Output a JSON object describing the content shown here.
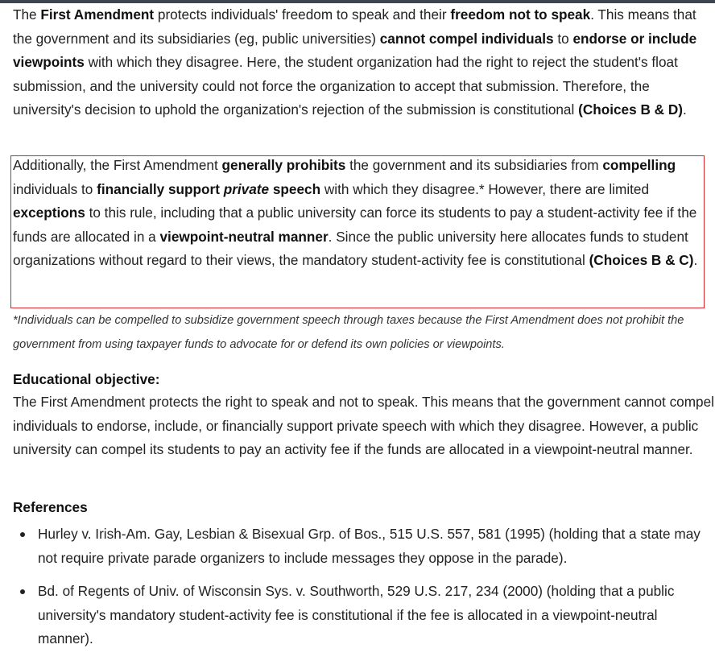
{
  "para1": {
    "t1": "The ",
    "b1": "First Amendment",
    "t2": " protects individuals' freedom to speak and their ",
    "b2": "freedom not to speak",
    "t3": ".  This means that the government and its subsidiaries (eg, public universities) ",
    "b3": "cannot compel individuals",
    "t4": " to ",
    "b4": "endorse or include viewpoints",
    "t5": " with which they disagree.  Here, the student organization had the right to reject the student's float submission, and the university could not force the organization to accept that submission.  Therefore, the university's decision to uphold the organization's rejection of the submission is constitutional ",
    "b5": "(Choices B & D)",
    "t6": "."
  },
  "para2": {
    "t1": "Additionally, the First Amendment ",
    "b1": "generally prohibits",
    "t2": " the government and its subsidiaries from ",
    "b2": "compelling",
    "t3": " individuals to ",
    "b3a": "financially support ",
    "b3i": "private",
    "b3b": " speech",
    "t4": " with which they disagree.*  However, there are limited ",
    "b4": "exceptions",
    "t5": " to this rule, including that a public university can force its students to pay a student-activity fee if the funds are allocated in a ",
    "b5": "viewpoint-neutral manner",
    "t6": ".  Since the public university here allocates funds to student organizations without regard to their views, the mandatory student-activity fee is constitutional ",
    "b6": "(Choices B & C)",
    "t7": "."
  },
  "footnote": "*Individuals can be compelled to subsidize government speech through taxes because the First Amendment does not prohibit the government from using taxpayer funds to advocate for or defend its own policies or viewpoints.",
  "educational_objective": {
    "heading": "Educational objective:",
    "body": "The First Amendment protects the right to speak and not to speak.  This means that the government cannot compel individuals to endorse, include, or financially support private speech with which they disagree.  However, a public university can compel its students to pay an activity fee if the funds are allocated in a viewpoint-neutral manner."
  },
  "references": {
    "heading": "References",
    "items": [
      "Hurley v. Irish-Am. Gay, Lesbian & Bisexual Grp. of Bos., 515 U.S. 557, 581 (1995) (holding that a state may not require private parade organizers to include messages they oppose in the parade).",
      "Bd. of Regents of Univ. of Wisconsin Sys. v. Southworth, 529 U.S. 217, 234 (2000) (holding that a public university's mandatory student-activity fee is constitutional if the fee is allocated in a viewpoint-neutral manner)."
    ]
  },
  "colors": {
    "highlight_border": "#d9252b",
    "top_bar": "#3c4550"
  }
}
